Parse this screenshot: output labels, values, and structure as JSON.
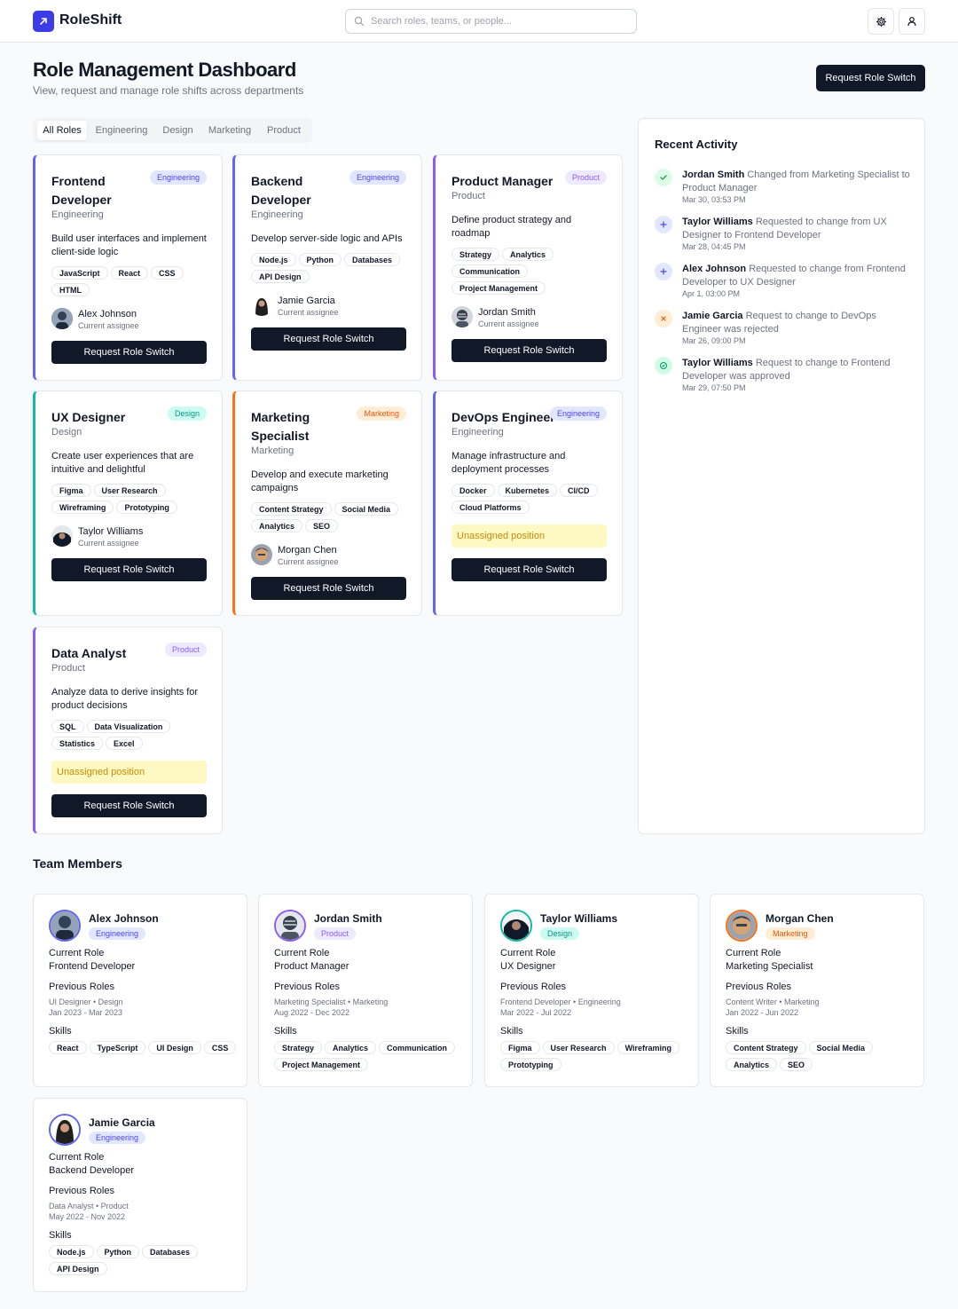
{
  "header": {
    "app_name": "RoleShift",
    "search_placeholder": "Search roles, teams, or people..."
  },
  "page": {
    "title": "Role Management Dashboard",
    "subtitle": "View, request and manage role shifts across departments",
    "primary_action": "Request Role Switch"
  },
  "tabs": [
    "All Roles",
    "Engineering",
    "Design",
    "Marketing",
    "Product"
  ],
  "colors": {
    "engineering": "#6366f1",
    "design": "#14b8a6",
    "marketing": "#f97316",
    "product": "#8b5cf6",
    "button": "#111827",
    "unassigned_bg": "#fef9c3"
  },
  "roles": [
    {
      "title": "Frontend Developer",
      "department": "Engineering",
      "badge": "Engineering",
      "description": "Build user interfaces and implement client-side logic",
      "skills": [
        "JavaScript",
        "React",
        "CSS",
        "HTML"
      ],
      "assignee": "Alex Johnson",
      "assignee_label": "Current assignee",
      "button": "Request Role Switch"
    },
    {
      "title": "Backend Developer",
      "department": "Engineering",
      "badge": "Engineering",
      "description": "Develop server-side logic and APIs",
      "skills": [
        "Node.js",
        "Python",
        "Databases",
        "API Design"
      ],
      "assignee": "Jamie Garcia",
      "assignee_label": "Current assignee",
      "button": "Request Role Switch"
    },
    {
      "title": "Product Manager",
      "department": "Product",
      "badge": "Product",
      "description": "Define product strategy and roadmap",
      "skills": [
        "Strategy",
        "Analytics",
        "Communication",
        "Project Management"
      ],
      "assignee": "Jordan Smith",
      "assignee_label": "Current assignee",
      "button": "Request Role Switch"
    },
    {
      "title": "UX Designer",
      "department": "Design",
      "badge": "Design",
      "description": "Create user experiences that are intuitive and delightful",
      "skills": [
        "Figma",
        "User Research",
        "Wireframing",
        "Prototyping"
      ],
      "assignee": "Taylor Williams",
      "assignee_label": "Current assignee",
      "button": "Request Role Switch"
    },
    {
      "title": "Marketing Specialist",
      "department": "Marketing",
      "badge": "Marketing",
      "description": "Develop and execute marketing campaigns",
      "skills": [
        "Content Strategy",
        "Social Media",
        "Analytics",
        "SEO"
      ],
      "assignee": "Morgan Chen",
      "assignee_label": "Current assignee",
      "button": "Request Role Switch"
    },
    {
      "title": "DevOps Engineer",
      "department": "Engineering",
      "badge": "Engineering",
      "description": "Manage infrastructure and deployment processes",
      "skills": [
        "Docker",
        "Kubernetes",
        "CI/CD",
        "Cloud Platforms"
      ],
      "unassigned": "Unassigned position",
      "button": "Request Role Switch"
    },
    {
      "title": "Data Analyst",
      "department": "Product",
      "badge": "Product",
      "description": "Analyze data to derive insights for product decisions",
      "skills": [
        "SQL",
        "Data Visualization",
        "Statistics",
        "Excel"
      ],
      "unassigned": "Unassigned position",
      "button": "Request Role Switch"
    }
  ],
  "activity": {
    "title": "Recent Activity",
    "items": [
      {
        "icon": "check-icon",
        "status": "completed",
        "name": "Jordan Smith",
        "text": "Changed from Marketing Specialist to Product Manager",
        "date": "Mar 30, 03:53 PM"
      },
      {
        "icon": "plus-icon",
        "status": "requested",
        "name": "Taylor Williams",
        "text": "Requested to change from UX Designer to Frontend Developer",
        "date": "Mar 28, 04:45 PM"
      },
      {
        "icon": "plus-icon",
        "status": "requested",
        "name": "Alex Johnson",
        "text": "Requested to change from Frontend Developer to UX Designer",
        "date": "Apr 1, 03:00 PM"
      },
      {
        "icon": "x-icon",
        "status": "rejected",
        "name": "Jamie Garcia",
        "text": "Request to change to DevOps Engineer was rejected",
        "date": "Mar 26, 09:00 PM"
      },
      {
        "icon": "check-circle-icon",
        "status": "approved",
        "name": "Taylor Williams",
        "text": "Request to change to Frontend Developer was approved",
        "date": "Mar 29, 07:50 PM"
      }
    ]
  },
  "team": {
    "title": "Team Members",
    "current_role_label": "Current Role",
    "previous_roles_label": "Previous Roles",
    "skills_label": "Skills",
    "members": [
      {
        "name": "Alex Johnson",
        "badge": "Engineering",
        "current_role": "Frontend Developer",
        "previous_role": "UI Designer • Design",
        "previous_dates": "Jan 2023 - Mar 2023",
        "skills": [
          "React",
          "TypeScript",
          "UI Design",
          "CSS"
        ]
      },
      {
        "name": "Jordan Smith",
        "badge": "Product",
        "current_role": "Product Manager",
        "previous_role": "Marketing Specialist • Marketing",
        "previous_dates": "Aug 2022 - Dec 2022",
        "skills": [
          "Strategy",
          "Analytics",
          "Communication",
          "Project Management"
        ]
      },
      {
        "name": "Taylor Williams",
        "badge": "Design",
        "current_role": "UX Designer",
        "previous_role": "Frontend Developer • Engineering",
        "previous_dates": "Mar 2022 - Jul 2022",
        "skills": [
          "Figma",
          "User Research",
          "Wireframing",
          "Prototyping"
        ]
      },
      {
        "name": "Morgan Chen",
        "badge": "Marketing",
        "current_role": "Marketing Specialist",
        "previous_role": "Content Writer • Marketing",
        "previous_dates": "Jan 2022 - Jun 2022",
        "skills": [
          "Content Strategy",
          "Social Media",
          "Analytics",
          "SEO"
        ]
      },
      {
        "name": "Jamie Garcia",
        "badge": "Engineering",
        "current_role": "Backend Developer",
        "previous_role": "Data Analyst • Product",
        "previous_dates": "May 2022 - Nov 2022",
        "skills": [
          "Node.js",
          "Python",
          "Databases",
          "API Design"
        ]
      }
    ]
  }
}
